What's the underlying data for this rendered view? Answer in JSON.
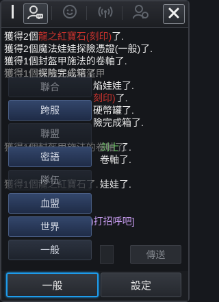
{
  "tabs": [
    {
      "name": "tab-all",
      "icon": "vertical-bar-icon"
    },
    {
      "name": "tab-chat",
      "icon": "speech-person-icon"
    },
    {
      "name": "tab-emote",
      "icon": "smiley-icon"
    },
    {
      "name": "tab-broadcast",
      "icon": "broadcast-icon"
    },
    {
      "name": "tab-settings-person",
      "icon": "person-gear-icon"
    }
  ],
  "close_icon": "close-icon",
  "chat_log": [
    {
      "pre": "獲得2個",
      "hl": "龍之紅寶石(刻印)",
      "hlc": "red",
      "post": "了."
    },
    {
      "pre": "獲得2個魔法娃娃探險憑證(一般)了.",
      "hl": "",
      "hlc": "",
      "post": ""
    },
    {
      "pre": "獲得1個封盔甲施法的卷軸了.",
      "hl": "",
      "hlc": "",
      "post": ""
    },
    {
      "pre": "獲得1個",
      "hl": "",
      "hlc": "",
      "post": "探險完成箱了."
    },
    {
      "pre": "",
      "hl": "",
      "hlc": "",
      "post": "焰娃娃了."
    },
    {
      "pre": "",
      "hl": "刻印)",
      "hlc": "red",
      "post": "了."
    },
    {
      "pre": "",
      "hl": "",
      "hlc": "",
      "post": "硬幣罐了."
    },
    {
      "pre": "",
      "hl": "",
      "hlc": "",
      "post": "險完成箱了."
    },
    {
      "pre": "",
      "hl": "",
      "hlc": "",
      "post": ""
    },
    {
      "pre": "",
      "hl": "劍士",
      "hlc": "green",
      "post": "了."
    },
    {
      "pre": "",
      "hl": "",
      "hlc": "",
      "post": "卷軸了."
    },
    {
      "pre": "",
      "hl": "",
      "hlc": "",
      "post": ""
    },
    {
      "pre": "",
      "hl": "",
      "hlc": "",
      "post": "娃娃了."
    },
    {
      "pre": "",
      "hl": "",
      "hlc": "",
      "post": ""
    },
    {
      "pre": "",
      "hl": "",
      "hlc": "",
      "post": ""
    },
    {
      "pre": "",
      "hl": ")打招呼吧]",
      "hlc": "purple",
      "post": ""
    }
  ],
  "faded_log": [
    "獲得1個大地之卷地盔甲",
    "獲得1個封盔甲施法的卷軸了.",
    "獲得1個龍之紅寶石了."
  ],
  "channel_menu": [
    {
      "label": "聯合",
      "style": "dark",
      "faded": true
    },
    {
      "label": "跨服",
      "style": "blue",
      "faded": false
    },
    {
      "label": "聯盟",
      "style": "dark",
      "faded": true
    },
    {
      "label": "密語",
      "style": "blue",
      "faded": false
    },
    {
      "label": "隊伍",
      "style": "dark",
      "faded": true
    },
    {
      "label": "血盟",
      "style": "blue",
      "faded": false
    },
    {
      "label": "世界",
      "style": "blue",
      "faded": false
    },
    {
      "label": "一般",
      "style": "dark",
      "faded": false
    }
  ],
  "send_label": "傳送",
  "bottom": {
    "channel_label": "一般",
    "settings_label": "設定"
  },
  "colors": {
    "accent": "#1e9bea",
    "highlight_red": "#c9322d",
    "highlight_green": "#74d56a",
    "highlight_purple": "#c79cf0"
  }
}
